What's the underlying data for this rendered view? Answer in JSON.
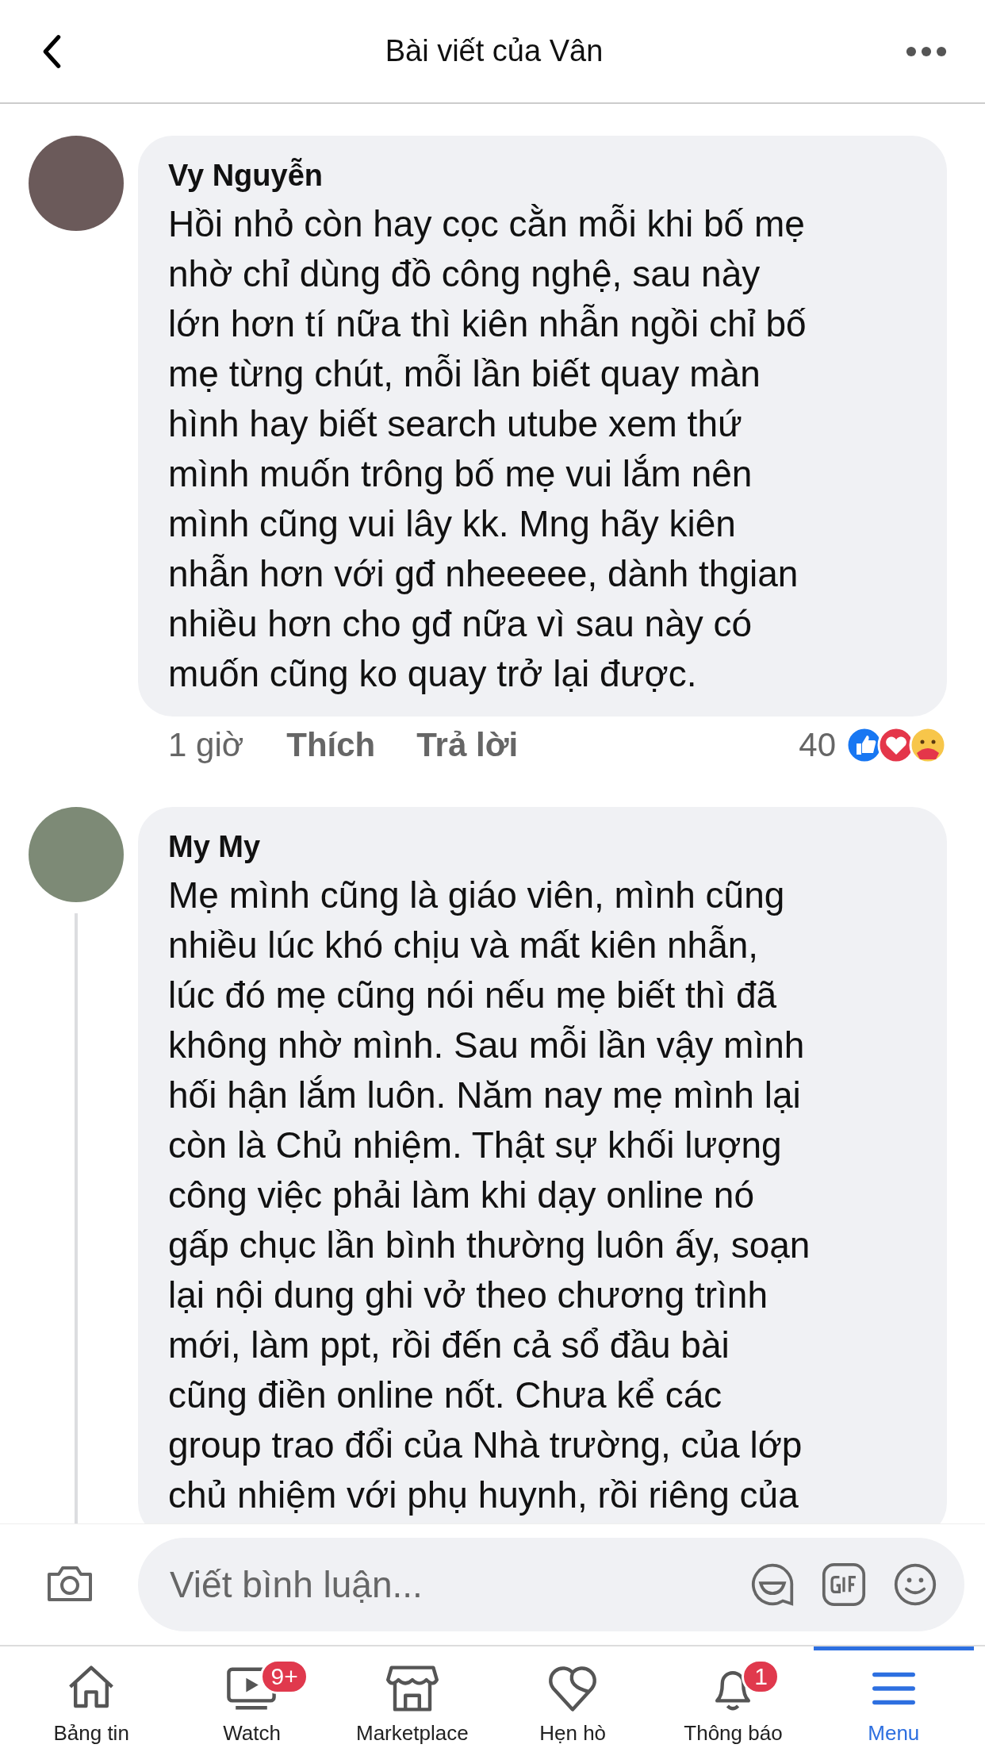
{
  "header": {
    "title": "Bài viết của Vân"
  },
  "comments": [
    {
      "author": "Vy Nguyễn",
      "lines": [
        "Hồi nhỏ còn hay cọc cằn mỗi khi bố mẹ",
        "nhờ chỉ dùng đồ công nghệ, sau này",
        "lớn hơn tí nữa thì kiên nhẫn ngồi chỉ bố",
        "mẹ từng chút, mỗi lần biết quay màn",
        "hình hay biết search utube xem thứ",
        "mình muốn trông bố mẹ vui lắm nên",
        "mình cũng vui lây kk. Mng hãy kiên",
        "nhẫn hơn với gđ nheeeee, dành thgian",
        "nhiều hơn cho gđ nữa vì sau này có",
        "muốn cũng ko quay trở lại được."
      ],
      "time": "1 giờ",
      "like": "Thích",
      "reply": "Trả lời",
      "reaction_count": "40",
      "has_replies": false
    },
    {
      "author": "My My",
      "lines": [
        "Mẹ mình cũng là giáo viên, mình cũng",
        "nhiều lúc khó chịu và mất kiên nhẫn,",
        "lúc đó mẹ cũng nói nếu mẹ biết thì đã",
        "không nhờ mình. Sau mỗi lần vậy mình",
        "hối hận lắm luôn. Năm nay mẹ mình lại",
        "còn là Chủ nhiệm. Thật sự khối lượng",
        "công việc phải làm khi dạy online nó",
        "gấp chục lần bình thường luôn ấy, soạn",
        "lại nội dung ghi vở theo chương trình",
        "mới, làm ppt, rồi đến cả sổ đầu bài",
        "cũng điền online nốt. Chưa kể các",
        "group trao đổi của Nhà trường, của lớp",
        "chủ nhiệm với phụ huynh, rồi riêng của"
      ],
      "has_replies": true
    }
  ],
  "composer": {
    "placeholder": "Viết bình luận..."
  },
  "tabs": [
    {
      "kind": "home",
      "label": "Bảng tin",
      "selected": false
    },
    {
      "kind": "watch",
      "label": "Watch",
      "badge": "9+",
      "selected": false
    },
    {
      "kind": "market",
      "label": "Marketplace",
      "selected": false
    },
    {
      "kind": "heart",
      "label": "Hẹn hò",
      "selected": false
    },
    {
      "kind": "bell",
      "label": "Thông báo",
      "badge": "1",
      "selected": false
    },
    {
      "kind": "menu",
      "label": "Menu",
      "selected": true
    }
  ]
}
